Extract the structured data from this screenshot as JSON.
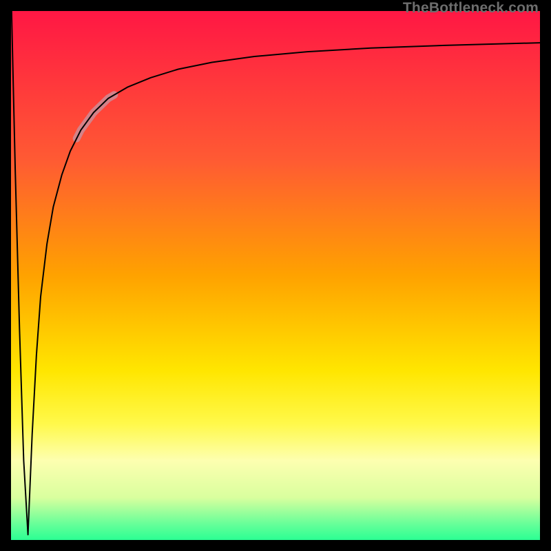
{
  "watermark": "TheBottleneck.com",
  "chart_data": {
    "type": "line",
    "title": "",
    "xlabel": "",
    "ylabel": "",
    "xlim": [
      0,
      100
    ],
    "ylim": [
      0,
      100
    ],
    "gradient": [
      {
        "pos": 0.0,
        "color": "#ff1744"
      },
      {
        "pos": 0.28,
        "color": "#ff5a33"
      },
      {
        "pos": 0.5,
        "color": "#ffa200"
      },
      {
        "pos": 0.68,
        "color": "#ffe600"
      },
      {
        "pos": 0.78,
        "color": "#fff94a"
      },
      {
        "pos": 0.85,
        "color": "#fdffb0"
      },
      {
        "pos": 0.92,
        "color": "#d9ff9e"
      },
      {
        "pos": 0.97,
        "color": "#66ff99"
      },
      {
        "pos": 1.0,
        "color": "#2bff93"
      }
    ],
    "series": [
      {
        "name": "bottleneck-curve",
        "x": [
          0.1,
          0.8,
          1.6,
          2.4,
          3.2,
          3.2,
          4.0,
          4.8,
          5.6,
          6.8,
          8.0,
          9.6,
          11.2,
          13.2,
          15.6,
          18.4,
          22.0,
          26.4,
          31.6,
          38.0,
          46.0,
          56.0,
          68.0,
          82.0,
          100.0
        ],
        "y": [
          100.0,
          70.0,
          40.0,
          15.0,
          1.0,
          1.0,
          20.0,
          35.0,
          46.0,
          56.0,
          63.0,
          69.0,
          73.5,
          77.5,
          80.8,
          83.5,
          85.6,
          87.4,
          89.0,
          90.3,
          91.4,
          92.3,
          93.0,
          93.5,
          94.0
        ]
      }
    ],
    "highlight": {
      "series": "bottleneck-curve",
      "x_start": 12.4,
      "x_end": 19.5
    }
  }
}
